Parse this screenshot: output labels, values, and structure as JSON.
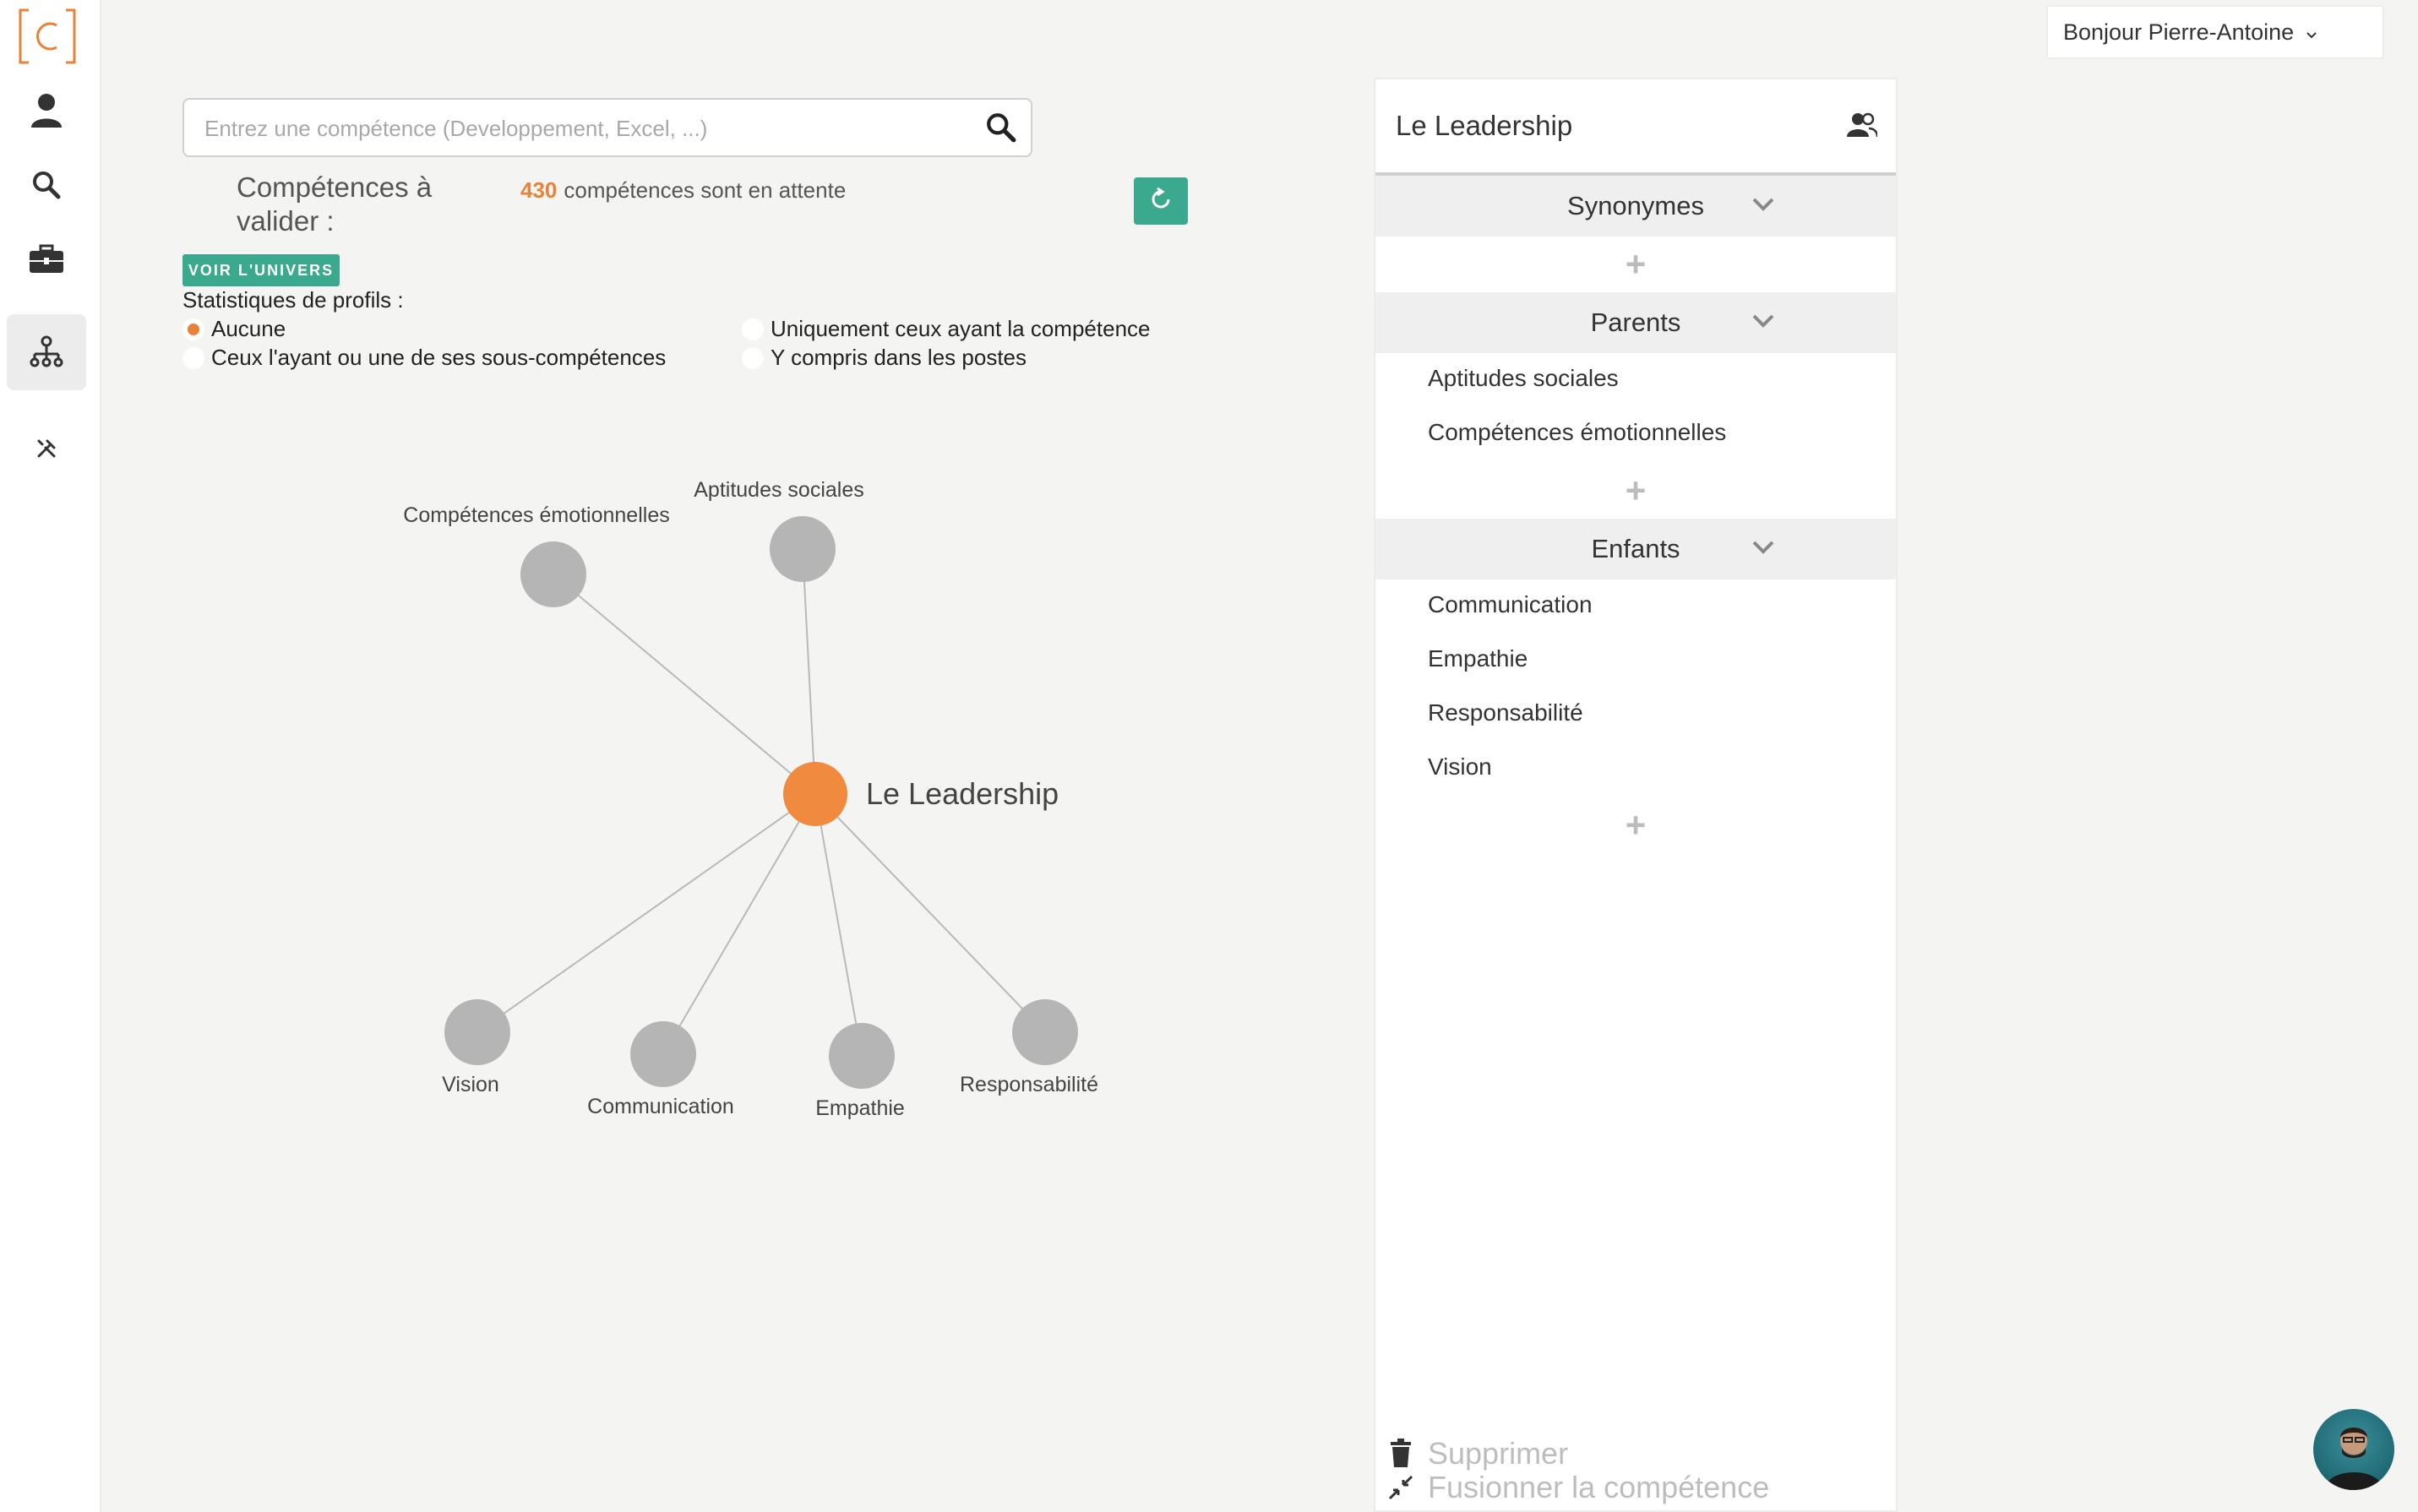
{
  "sidebar": {
    "logo_icon": "bracket-c-logo",
    "items": [
      {
        "name": "profile",
        "icon": "person-icon"
      },
      {
        "name": "search",
        "icon": "search-icon"
      },
      {
        "name": "jobs",
        "icon": "briefcase-icon"
      },
      {
        "name": "skills-tree",
        "icon": "hierarchy-icon",
        "active": true
      },
      {
        "name": "tools",
        "icon": "tools-icon"
      }
    ]
  },
  "search": {
    "placeholder": "Entrez une compétence (Developpement, Excel, ...)",
    "value": ""
  },
  "pending": {
    "title": "Compétences à valider :",
    "count": "430",
    "count_text": "compétences sont en attente"
  },
  "univers_button": "VOIR L'UNIVERS",
  "stats": {
    "label": "Statistiques de profils :",
    "options": [
      {
        "label": "Aucune",
        "checked": true
      },
      {
        "label": "Uniquement ceux ayant la compétence",
        "checked": false
      },
      {
        "label": "Ceux l'ayant ou une de ses sous-compétences",
        "checked": false
      },
      {
        "label": "Y compris dans les postes",
        "checked": false
      }
    ]
  },
  "graph": {
    "center": "Le Leadership",
    "parents": [
      "Compétences émotionnelles",
      "Aptitudes sociales"
    ],
    "children": [
      "Vision",
      "Communication",
      "Empathie",
      "Responsabilité"
    ],
    "colors": {
      "center": "#ef8a3f",
      "node": "#b5b5b5",
      "edge": "#b9b9b9"
    }
  },
  "panel": {
    "title": "Le Leadership",
    "header_icon": "users-icon",
    "sections": {
      "synonymes": {
        "label": "Synonymes",
        "items": []
      },
      "parents": {
        "label": "Parents",
        "items": [
          "Aptitudes sociales",
          "Compétences émotionnelles"
        ]
      },
      "enfants": {
        "label": "Enfants",
        "items": [
          "Communication",
          "Empathie",
          "Responsabilité",
          "Vision"
        ]
      }
    },
    "add_symbol": "+",
    "actions": {
      "delete": "Supprimer",
      "merge": "Fusionner la compétence"
    }
  },
  "user": {
    "greeting": "Bonjour Pierre-Antoine"
  },
  "colors": {
    "accent": "#e8813a",
    "green": "#3aa98d"
  }
}
